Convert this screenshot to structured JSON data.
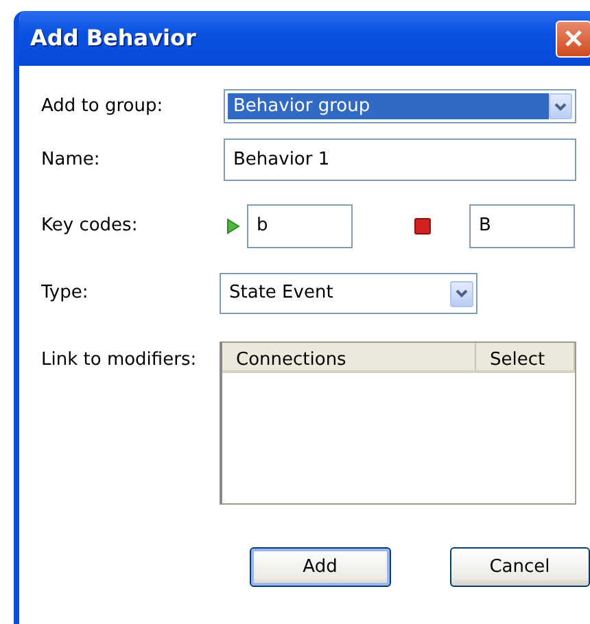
{
  "window": {
    "title": "Add Behavior"
  },
  "add_to_group": {
    "label": "Add to group:",
    "value": "Behavior group",
    "focused": true
  },
  "name": {
    "label": "Name:",
    "value": "Behavior 1"
  },
  "key_codes": {
    "label": "Key codes:",
    "press": "b",
    "release": "B"
  },
  "type": {
    "label": "Type:",
    "value": "State Event"
  },
  "link_to_modifiers": {
    "label": "Link to modifiers:",
    "columns": [
      "Connections",
      "Select"
    ]
  },
  "buttons": [
    {
      "label": "Add",
      "default": true
    },
    {
      "label": "Cancel",
      "default": false
    }
  ]
}
